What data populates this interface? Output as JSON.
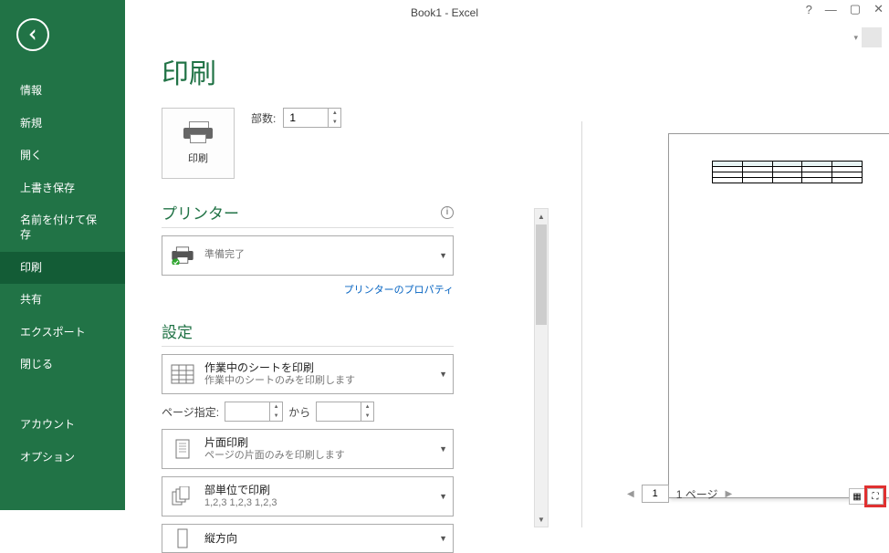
{
  "title": "Book1 - Excel",
  "window": {
    "help": "?",
    "min": "—",
    "max": "▢",
    "close": "✕"
  },
  "sidebar": {
    "items": [
      "情報",
      "新規",
      "開く",
      "上書き保存",
      "名前を付けて保存",
      "印刷",
      "共有",
      "エクスポート",
      "閉じる"
    ],
    "footer": [
      "アカウント",
      "オプション"
    ],
    "selectedIndex": 5
  },
  "page": {
    "heading": "印刷"
  },
  "printButton": {
    "label": "印刷"
  },
  "copies": {
    "label": "部数:",
    "value": "1"
  },
  "printerSection": {
    "title": "プリンター"
  },
  "printer": {
    "status": "準備完了",
    "propsLink": "プリンターのプロパティ"
  },
  "settingsSection": {
    "title": "設定"
  },
  "settings": {
    "scope": {
      "title": "作業中のシートを印刷",
      "sub": "作業中のシートのみを印刷します"
    },
    "rangeLabel": "ページ指定:",
    "rangeTo": "から",
    "duplex": {
      "title": "片面印刷",
      "sub": "ページの片面のみを印刷します"
    },
    "collate": {
      "title": "部単位で印刷",
      "sub": "1,2,3    1,2,3    1,2,3"
    },
    "orientation": {
      "title": "縦方向"
    }
  },
  "preview": {
    "nav": {
      "current": "1",
      "ofLabel": "1 ページ"
    }
  },
  "colors": {
    "brand": "#217346"
  }
}
